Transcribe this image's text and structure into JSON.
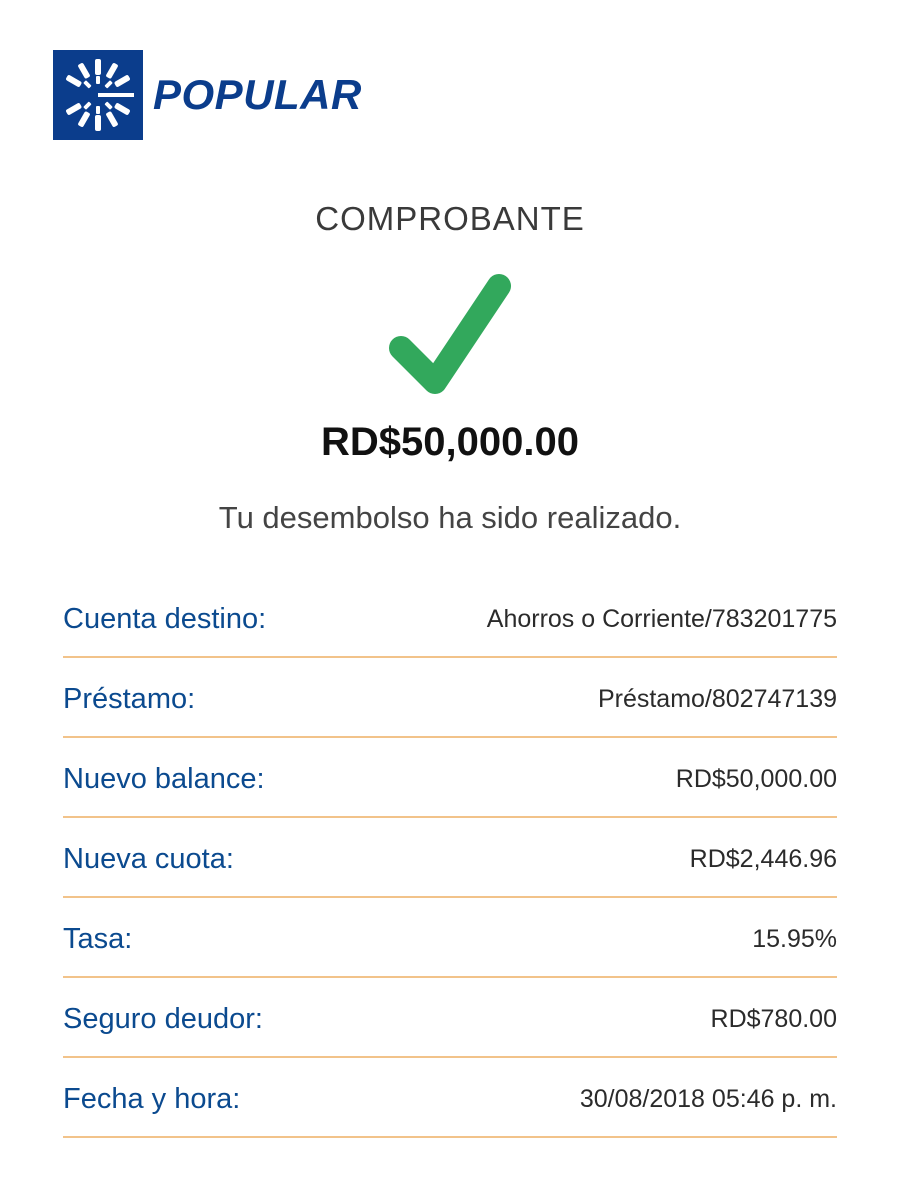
{
  "brand": {
    "name": "POPULAR",
    "color": "#0b3d8c"
  },
  "receipt": {
    "title": "COMPROBANTE",
    "status_icon": "checkmark-icon",
    "status_color": "#32a85c",
    "amount": "RD$50,000.00",
    "message": "Tu desembolso ha sido realizado."
  },
  "details": [
    {
      "label": "Cuenta destino:",
      "value": "Ahorros o Corriente/783201775"
    },
    {
      "label": "Préstamo:",
      "value": "Préstamo/802747139"
    },
    {
      "label": "Nuevo balance:",
      "value": "RD$50,000.00"
    },
    {
      "label": "Nueva cuota:",
      "value": "RD$2,446.96"
    },
    {
      "label": "Tasa:",
      "value": "15.95%"
    },
    {
      "label": "Seguro deudor:",
      "value": "RD$780.00"
    },
    {
      "label": "Fecha y hora:",
      "value": "30/08/2018 05:46 p. m."
    }
  ],
  "colors": {
    "label": "#0b4a8f",
    "divider": "#f2c38a"
  }
}
